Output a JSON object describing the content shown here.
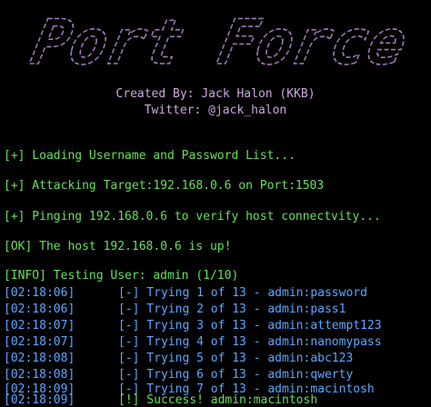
{
  "banner": {
    "title": "Port Force",
    "stroke_color": "#9c7bb5"
  },
  "credits": {
    "created_by": "Created By: Jack Halon (KKB)",
    "twitter": "Twitter: @jack_halon"
  },
  "status_lines": [
    "[+] Loading Username and Password List...",
    "[+] Attacking Target:192.168.0.6 on Port:1503",
    "[+] Pinging 192.168.0.6 to verify host connectvity...",
    "[OK] The host 192.168.0.6 is up!",
    "[INFO] Testing User: admin (1/10)"
  ],
  "attempts": [
    {
      "time": "[02:18:06]",
      "message": "[-] Trying 1 of 13 - admin:password"
    },
    {
      "time": "[02:18:06]",
      "message": "[-] Trying 2 of 13 - admin:pass1"
    },
    {
      "time": "[02:18:07]",
      "message": "[-] Trying 3 of 13 - admin:attempt123"
    },
    {
      "time": "[02:18:07]",
      "message": "[-] Trying 4 of 13 - admin:nanomypass"
    },
    {
      "time": "[02:18:08]",
      "message": "[-] Trying 5 of 13 - admin:abc123"
    },
    {
      "time": "[02:18:08]",
      "message": "[-] Trying 6 of 13 - admin:qwerty"
    },
    {
      "time": "[02:18:09]",
      "message": "[-] Trying 7 of 13 - admin:macintosh"
    }
  ],
  "success": {
    "time": "[02:18:09]",
    "message": "[!] Success! admin:macintosh"
  },
  "colors": {
    "background": "#000000",
    "green": "#66e05a",
    "blue": "#58a8ff",
    "purple": "#c9a8dc"
  }
}
